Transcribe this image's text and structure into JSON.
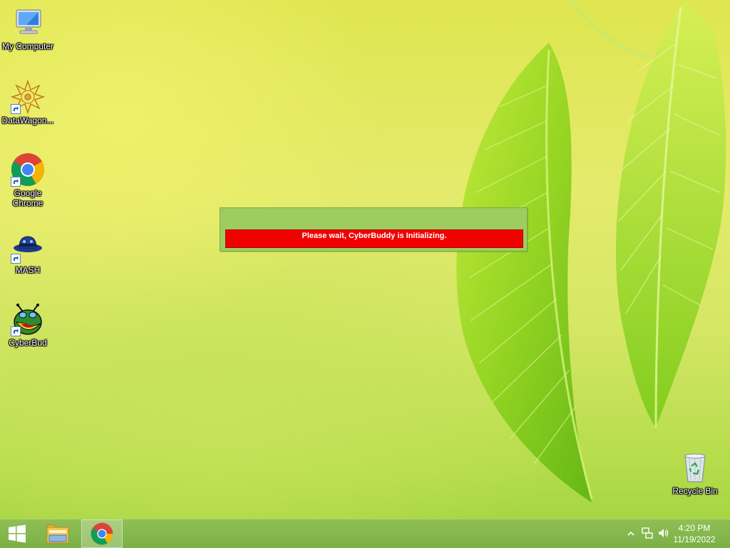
{
  "desktop": {
    "icons": [
      {
        "label": "My Computer"
      },
      {
        "label": "DataWagon..."
      },
      {
        "label": "Google Chrome"
      },
      {
        "label": "MASH"
      },
      {
        "label": "CyberBud"
      },
      {
        "label": "Recycle Bin"
      }
    ]
  },
  "splash": {
    "message": "Please wait, CyberBuddy is Initializing."
  },
  "taskbar": {
    "time": "4:20 PM",
    "date": "11/19/2022"
  },
  "colors": {
    "splash_bg": "#9ccd5e",
    "progress_bar": "#f00000",
    "taskbar": "#7bb046"
  }
}
